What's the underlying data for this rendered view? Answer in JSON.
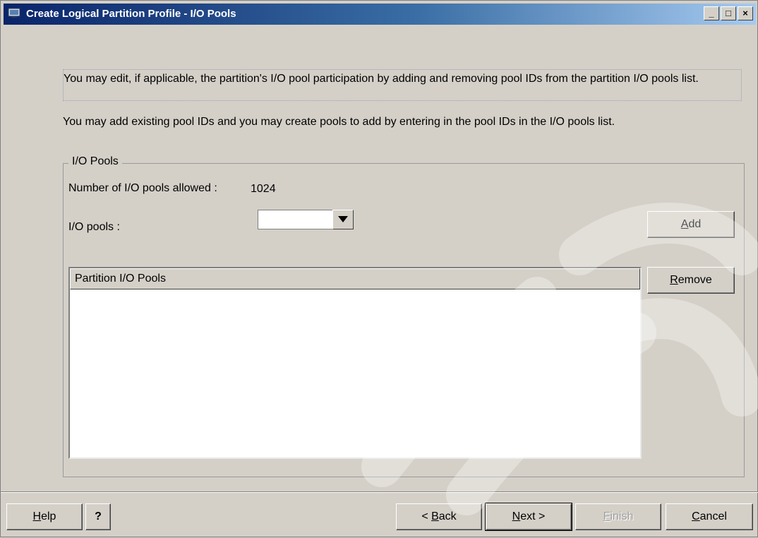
{
  "window": {
    "title": "Create Logical Partition Profile - I/O Pools",
    "minimize_glyph": "_",
    "maximize_glyph": "□",
    "close_glyph": "×"
  },
  "intro": {
    "paragraph1": "You may edit, if applicable, the partition's I/O pool participation by adding and removing pool IDs from the partition I/O pools list.",
    "paragraph2": "You may add existing pool IDs and you may create pools to add by entering in the pool IDs in the I/O pools list."
  },
  "io_pools_group": {
    "title": "I/O Pools",
    "allowed_label": "Number of I/O pools allowed :",
    "allowed_value": "1024",
    "pools_label": "I/O pools :",
    "pools_value": "",
    "add_button": {
      "mnemonic": "A",
      "rest": "dd"
    },
    "remove_button": {
      "mnemonic": "R",
      "rest": "emove"
    },
    "list_header": "Partition I/O Pools"
  },
  "footer": {
    "help_button": {
      "mnemonic": "H",
      "rest": "elp"
    },
    "question_button": "?",
    "back_button": {
      "prefix": "< ",
      "mnemonic": "B",
      "rest": "ack"
    },
    "next_button": {
      "mnemonic": "N",
      "rest": "ext >"
    },
    "finish_button": {
      "mnemonic": "F",
      "rest": "inish"
    },
    "cancel_button": {
      "mnemonic": "C",
      "rest": "ancel"
    }
  },
  "icons": {
    "app": "monitor-icon",
    "combo_arrow": "triangle-down-icon"
  },
  "colors": {
    "titlebar_start": "#0a246a",
    "titlebar_end": "#a6caf0",
    "face": "#d4d0c8",
    "disabled_text": "#a0a0a0"
  }
}
